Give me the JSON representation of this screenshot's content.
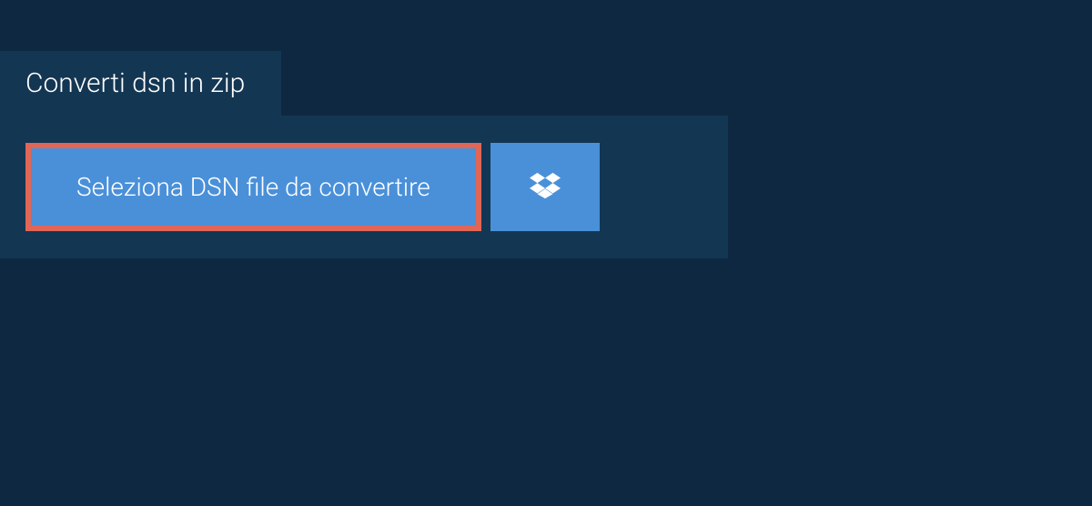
{
  "tab": {
    "label": "Converti dsn in zip"
  },
  "actions": {
    "select_file_label": "Seleziona DSN file da convertire"
  }
}
